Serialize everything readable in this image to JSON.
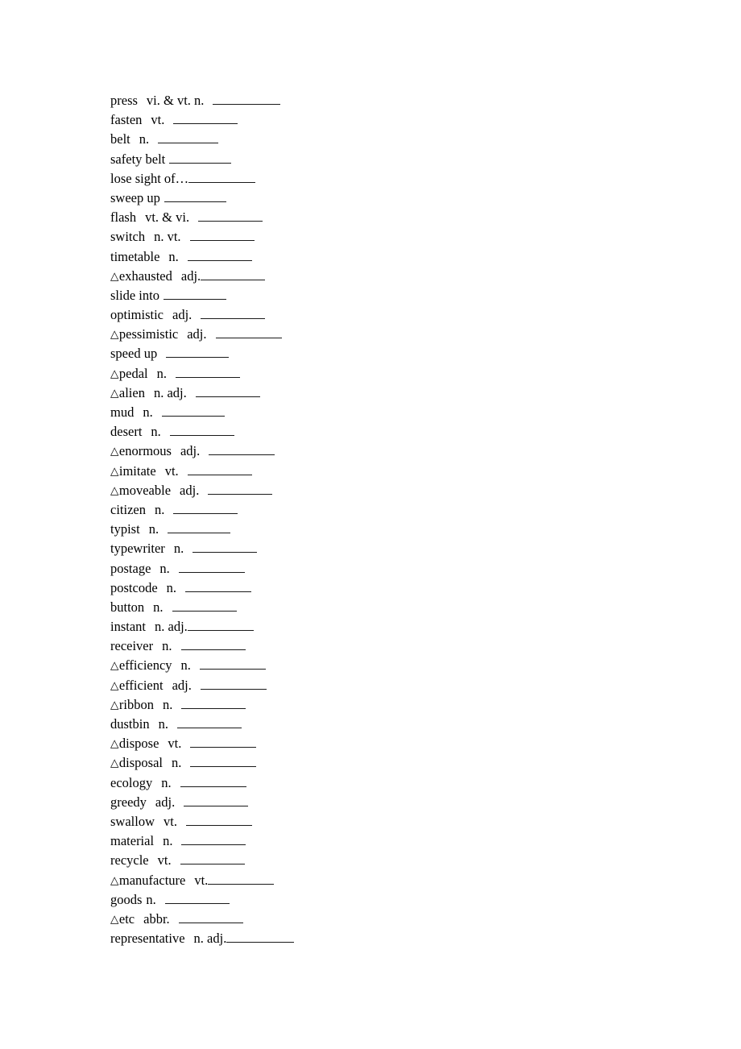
{
  "document": {
    "type": "vocabulary-worksheet",
    "marker_glyph": "△",
    "blank_char": "_",
    "background_color": "#ffffff",
    "text_color": "#000000",
    "rule_color": "#1a1a1a"
  },
  "entries": [
    {
      "marker": "",
      "term": "press",
      "pos": "vi. & vt.   n.",
      "gap_before_pos": "md",
      "gap_before_blank": "md",
      "blank_width": 84
    },
    {
      "marker": "",
      "term": "fasten",
      "pos": "vt.",
      "gap_before_pos": "md",
      "gap_before_blank": "md",
      "blank_width": 80
    },
    {
      "marker": "",
      "term": "belt",
      "pos": "n.",
      "gap_before_pos": "md",
      "gap_before_blank": "md",
      "blank_width": 75
    },
    {
      "marker": "",
      "term": "safety belt",
      "pos": "",
      "gap_before_pos": "none",
      "gap_before_blank": "sm",
      "blank_width": 77
    },
    {
      "marker": "",
      "term": "lose sight of…",
      "pos": "",
      "gap_before_pos": "none",
      "gap_before_blank": "none",
      "blank_width": 83
    },
    {
      "marker": "",
      "term": "sweep up",
      "pos": "",
      "gap_before_pos": "none",
      "gap_before_blank": "sm",
      "blank_width": 77
    },
    {
      "marker": "",
      "term": "flash",
      "pos": "vt. & vi.",
      "gap_before_pos": "md",
      "gap_before_blank": "md",
      "blank_width": 80
    },
    {
      "marker": "",
      "term": "switch",
      "pos": "n.   vt.",
      "gap_before_pos": "md",
      "gap_before_blank": "md",
      "blank_width": 80
    },
    {
      "marker": "",
      "term": "timetable",
      "pos": "n.",
      "gap_before_pos": "md",
      "gap_before_blank": "md",
      "blank_width": 80
    },
    {
      "marker": "△",
      "term": "exhausted",
      "pos": "adj.",
      "gap_before_pos": "md",
      "gap_before_blank": "none",
      "blank_width": 80
    },
    {
      "marker": "",
      "term": "slide into",
      "pos": "",
      "gap_before_pos": "none",
      "gap_before_blank": "sm",
      "blank_width": 78
    },
    {
      "marker": "",
      "term": "optimistic",
      "pos": "adj.",
      "gap_before_pos": "md",
      "gap_before_blank": "md",
      "blank_width": 80
    },
    {
      "marker": "△",
      "term": "pessimistic",
      "pos": "adj.",
      "gap_before_pos": "md",
      "gap_before_blank": "md",
      "blank_width": 82
    },
    {
      "marker": "",
      "term": "speed up",
      "pos": "",
      "gap_before_pos": "none",
      "gap_before_blank": "md",
      "blank_width": 78
    },
    {
      "marker": "△",
      "term": "pedal",
      "pos": "n.",
      "gap_before_pos": "md",
      "gap_before_blank": "md",
      "blank_width": 80
    },
    {
      "marker": "△",
      "term": "alien",
      "pos": "n.   adj.",
      "gap_before_pos": "md",
      "gap_before_blank": "md",
      "blank_width": 80
    },
    {
      "marker": "",
      "term": "mud",
      "pos": "n.",
      "gap_before_pos": "md",
      "gap_before_blank": "md",
      "blank_width": 78
    },
    {
      "marker": "",
      "term": "desert",
      "pos": "n.",
      "gap_before_pos": "md",
      "gap_before_blank": "md",
      "blank_width": 80
    },
    {
      "marker": "△",
      "term": "enormous",
      "pos": "adj.",
      "gap_before_pos": "md",
      "gap_before_blank": "md",
      "blank_width": 82
    },
    {
      "marker": "△",
      "term": "imitate",
      "pos": "vt.",
      "gap_before_pos": "md",
      "gap_before_blank": "md",
      "blank_width": 80
    },
    {
      "marker": "△",
      "term": "moveable",
      "pos": "adj.",
      "gap_before_pos": "md",
      "gap_before_blank": "md",
      "blank_width": 80
    },
    {
      "marker": "",
      "term": "citizen",
      "pos": "n.",
      "gap_before_pos": "md",
      "gap_before_blank": "md",
      "blank_width": 80
    },
    {
      "marker": "",
      "term": "typist",
      "pos": "n.",
      "gap_before_pos": "md",
      "gap_before_blank": "md",
      "blank_width": 78
    },
    {
      "marker": "",
      "term": "typewriter",
      "pos": "n.",
      "gap_before_pos": "md",
      "gap_before_blank": "md",
      "blank_width": 80
    },
    {
      "marker": "",
      "term": "postage",
      "pos": "n.",
      "gap_before_pos": "md",
      "gap_before_blank": "md",
      "blank_width": 82
    },
    {
      "marker": "",
      "term": "postcode",
      "pos": "n.",
      "gap_before_pos": "md",
      "gap_before_blank": "md",
      "blank_width": 82
    },
    {
      "marker": "",
      "term": "button",
      "pos": "n.",
      "gap_before_pos": "md",
      "gap_before_blank": "md",
      "blank_width": 80
    },
    {
      "marker": "",
      "term": "instant",
      "pos": "n.   adj.",
      "gap_before_pos": "md",
      "gap_before_blank": "none",
      "blank_width": 82
    },
    {
      "marker": "",
      "term": "receiver",
      "pos": "n.",
      "gap_before_pos": "md",
      "gap_before_blank": "md",
      "blank_width": 80
    },
    {
      "marker": "△",
      "term": "efficiency",
      "pos": "n.",
      "gap_before_pos": "md",
      "gap_before_blank": "md",
      "blank_width": 82
    },
    {
      "marker": "△",
      "term": "efficient",
      "pos": "adj.",
      "gap_before_pos": "md",
      "gap_before_blank": "md",
      "blank_width": 82
    },
    {
      "marker": "△",
      "term": "ribbon",
      "pos": "n.",
      "gap_before_pos": "md",
      "gap_before_blank": "md",
      "blank_width": 80
    },
    {
      "marker": "",
      "term": "dustbin",
      "pos": "n.",
      "gap_before_pos": "md",
      "gap_before_blank": "md",
      "blank_width": 80
    },
    {
      "marker": "△",
      "term": "dispose",
      "pos": "vt.",
      "gap_before_pos": "md",
      "gap_before_blank": "md",
      "blank_width": 82
    },
    {
      "marker": "△",
      "term": "disposal",
      "pos": "n.",
      "gap_before_pos": "md",
      "gap_before_blank": "md",
      "blank_width": 82
    },
    {
      "marker": "",
      "term": "ecology",
      "pos": "n.",
      "gap_before_pos": "md",
      "gap_before_blank": "md",
      "blank_width": 82
    },
    {
      "marker": "",
      "term": "greedy",
      "pos": "adj.",
      "gap_before_pos": "md",
      "gap_before_blank": "md",
      "blank_width": 80
    },
    {
      "marker": "",
      "term": "swallow",
      "pos": "vt.",
      "gap_before_pos": "md",
      "gap_before_blank": "md",
      "blank_width": 82
    },
    {
      "marker": "",
      "term": "material",
      "pos": "n.",
      "gap_before_pos": "md",
      "gap_before_blank": "md",
      "blank_width": 80
    },
    {
      "marker": "",
      "term": "recycle",
      "pos": "vt.",
      "gap_before_pos": "md",
      "gap_before_blank": "md",
      "blank_width": 80
    },
    {
      "marker": "△",
      "term": "manufacture",
      "pos": "vt.",
      "gap_before_pos": "md",
      "gap_before_blank": "none",
      "blank_width": 82
    },
    {
      "marker": "",
      "term": "goods",
      "pos": "n.",
      "gap_before_pos": "sm",
      "gap_before_blank": "md",
      "blank_width": 80
    },
    {
      "marker": "△",
      "term": "etc",
      "pos": "abbr.",
      "gap_before_pos": "md",
      "gap_before_blank": "md",
      "blank_width": 80
    },
    {
      "marker": "",
      "term": "representative",
      "pos": "n.     adj.",
      "gap_before_pos": "md",
      "gap_before_blank": "none",
      "blank_width": 84
    }
  ]
}
